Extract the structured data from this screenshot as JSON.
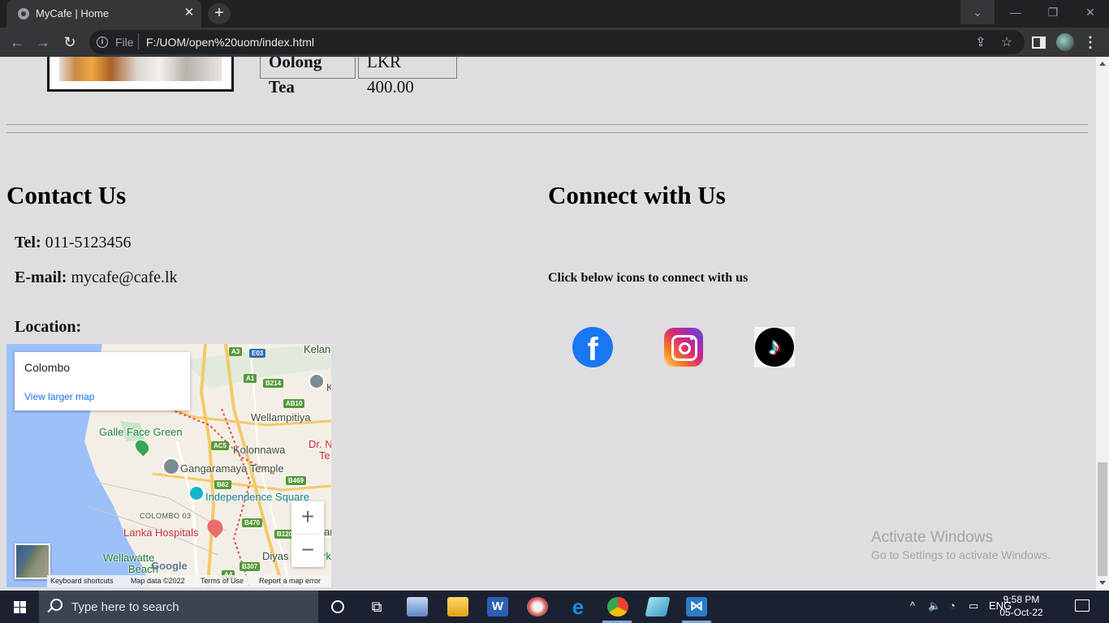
{
  "browser": {
    "tab_title": "MyCafe | Home",
    "tab_close": "✕",
    "new_tab": "+",
    "url_scheme": "File",
    "url": "F:/UOM/open%20uom/index.html",
    "info_icon": "i"
  },
  "menu": {
    "row": {
      "name": "Oolong Tea",
      "price": "LKR 400.00"
    }
  },
  "contact": {
    "heading": "Contact Us",
    "tel_label": "Tel:",
    "tel_value": "011-5123456",
    "email_label": "E-mail:",
    "email_value": "mycafe@cafe.lk",
    "location_label": "Location:"
  },
  "connect": {
    "heading": "Connect with Us",
    "instruction": "Click below icons to connect with us",
    "icons": [
      "facebook-icon",
      "instagram-icon",
      "tiktok-icon"
    ],
    "fb_glyph": "f",
    "tiktok_glyph": "♪"
  },
  "map": {
    "place_name": "Colombo",
    "larger_map_link": "View larger map",
    "zoom_in": "+",
    "zoom_out": "−",
    "labels": {
      "kelan": "Kelan",
      "galle_face": "Galle Face Green",
      "wellampitiya": "Wellampitiya",
      "kolonnawa": "Kolonnawa",
      "dr_n": "Dr. N",
      "te": "Te",
      "gangaramaya": "Gangaramaya Temple",
      "independence": "Independence Square",
      "colombo03": "COLOMBO 03",
      "lanka_hospitals": "Lanka Hospitals",
      "wellawatte": "Wellawatte",
      "beach": "Beach",
      "diyas": "Diyas",
      "rk": "rk",
      "k": "K",
      "ar": "ar"
    },
    "shields": {
      "a3": "A3",
      "e03": "E03",
      "a1": "A1",
      "b214": "B214",
      "ab10": "AB10",
      "ac5": "AC5",
      "b62": "B62",
      "b469": "B469",
      "b470": "B470",
      "b120": "B120",
      "b307": "B307",
      "a4": "A4"
    },
    "google": "Google",
    "footer": {
      "shortcuts": "Keyboard shortcuts",
      "data": "Map data ©2022",
      "terms": "Terms of Use",
      "report": "Report a map error"
    }
  },
  "watermark": {
    "line1": "Activate Windows",
    "line2": "Go to Settings to activate Windows."
  },
  "taskbar": {
    "search_placeholder": "Type here to search",
    "language": "ENG",
    "time": "9:58 PM",
    "date": "05-Oct-22"
  }
}
